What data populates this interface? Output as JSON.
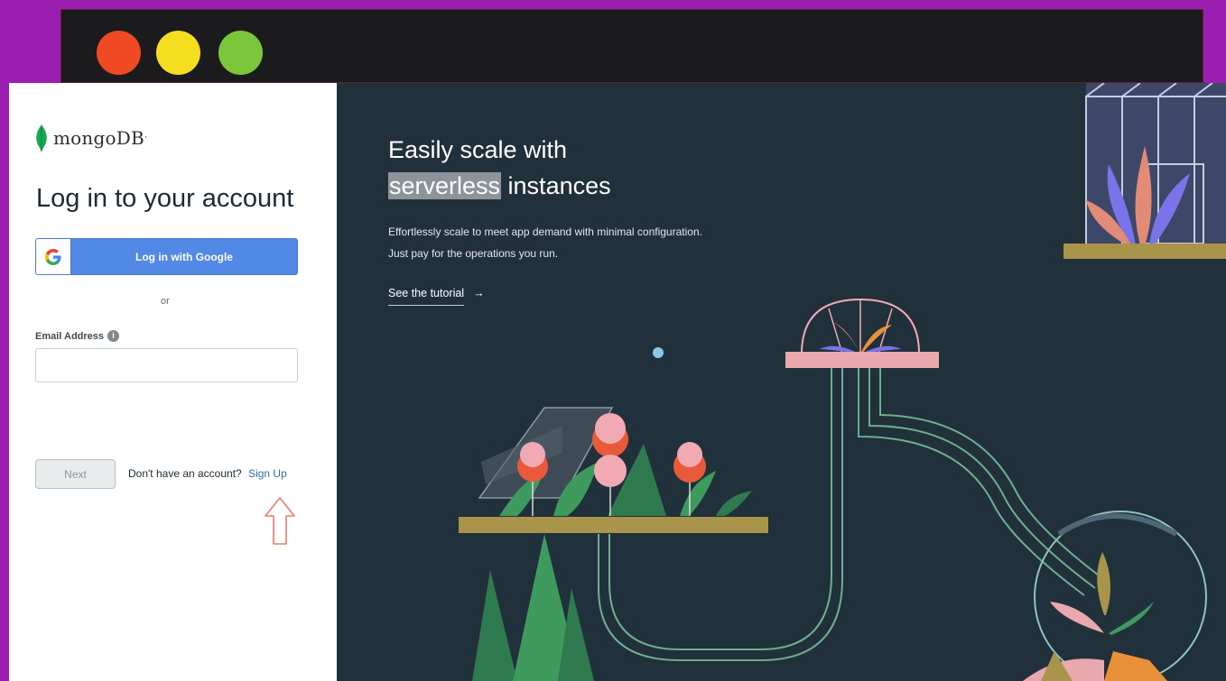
{
  "window": {
    "controls": [
      "close",
      "minimize",
      "maximize"
    ],
    "colors": {
      "close": "#f04a24",
      "minimize": "#f5dd1f",
      "maximize": "#7cc63c"
    }
  },
  "login": {
    "logo_text": "mongoDB",
    "heading": "Log in to your account",
    "google_button": "Log in with Google",
    "or_text": "or",
    "email_label": "Email Address",
    "email_value": "",
    "next_button": "Next",
    "no_account_text": "Don't have an account?",
    "signup_link": "Sign Up"
  },
  "promo": {
    "title_line1": "Easily scale with",
    "title_highlight": "serverless",
    "title_line2_rest": "instances",
    "description": "Effortlessly scale to meet app demand with minimal configuration. Just pay for the operations you run.",
    "tutorial_link": "See the tutorial",
    "tutorial_arrow": "→"
  },
  "colors": {
    "frame_background": "#9a1fb0",
    "titlebar": "#1b1b1d",
    "promo_background": "#21313c",
    "google_blue": "#5288e6",
    "link_blue": "#2d6fb6",
    "mongo_green": "#13aa52",
    "annotation_arrow": "#f07a6a"
  },
  "icons": {
    "logo": "mongodb-leaf-icon",
    "google": "google-g-icon",
    "info": "info-icon",
    "annotation": "up-arrow-icon"
  }
}
